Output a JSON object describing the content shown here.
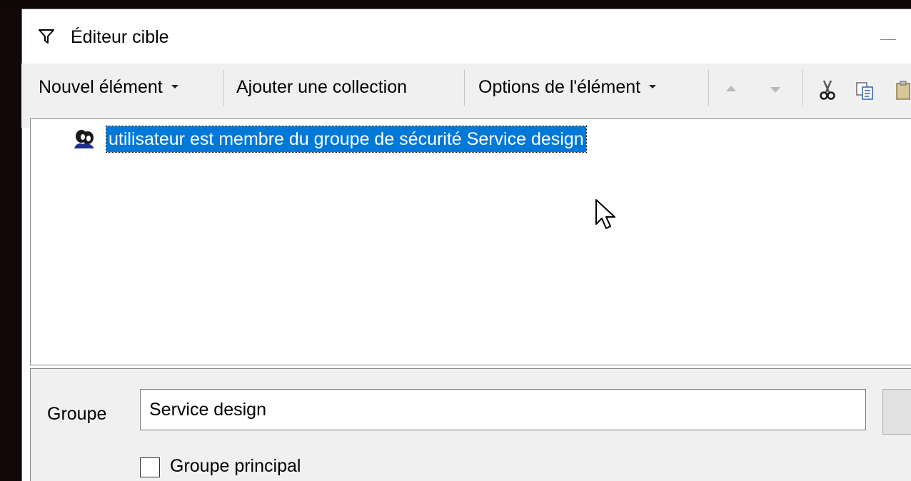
{
  "window": {
    "title": "Éditeur cible"
  },
  "toolbar": {
    "new_item_label": "Nouvel élément",
    "add_collection_label": "Ajouter une collection",
    "item_options_label": "Options de l'élément",
    "move_up_icon": "arrow-up-icon",
    "move_down_icon": "arrow-down-icon",
    "cut_icon": "scissors-icon",
    "copy_icon": "copy-icon",
    "paste_icon": "paste-icon"
  },
  "tree": {
    "items": [
      {
        "label": "utilisateur est membre du groupe de sécurité  Service design",
        "icon": "users-group-icon",
        "selected": true
      }
    ]
  },
  "properties": {
    "group_label": "Groupe",
    "group_value": "Service design",
    "primary_group_label": "Groupe principal",
    "primary_group_checked": false
  },
  "colors": {
    "selection": "#0078d7",
    "toolbar_bg": "#f0f0f0",
    "props_bg": "#f0f0f0"
  }
}
